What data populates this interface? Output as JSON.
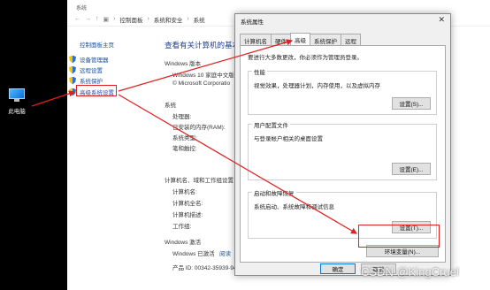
{
  "desktop": {
    "icon_label": "此电脑"
  },
  "window": {
    "title": "系统",
    "breadcrumb": [
      "控制面板",
      "系统和安全",
      "系统"
    ]
  },
  "sidebar": {
    "home": "控制面板主页",
    "items": [
      {
        "label": "设备管理器"
      },
      {
        "label": "远程设置"
      },
      {
        "label": "系统保护"
      },
      {
        "label": "高级系统设置"
      }
    ]
  },
  "main": {
    "heading": "查看有关计算机的基本",
    "edition_section": "Windows 版本",
    "edition": "Windows 10 家庭中文版",
    "copyright": "© Microsoft Corporatio",
    "system_section": "系统",
    "processor_label": "处理器:",
    "ram_label": "已安装的内存(RAM):",
    "sys_type_label": "系统类型:",
    "pen_label": "笔和触控:",
    "computer_section": "计算机名、域和工作组设置",
    "computer_name_label": "计算机名:",
    "full_name_label": "计算机全名:",
    "desc_label": "计算机描述:",
    "workgroup_label": "工作组:",
    "activation_section": "Windows 激活",
    "activated": "Windows 已激活",
    "license_link": "阅读",
    "product_id": "产品 ID: 00342-35939-94"
  },
  "dialog": {
    "title": "系统属性",
    "close": "✕",
    "tabs": [
      "计算机名",
      "硬件",
      "高级",
      "系统保护",
      "远程"
    ],
    "active_tab": "高级",
    "note": "要进行大多数更改，你必须作为管理员登录。",
    "performance": {
      "label": "性能",
      "desc": "视觉效果，处理器计划，内存使用，以及虚拟内存",
      "button": "设置(S)..."
    },
    "profiles": {
      "label": "用户配置文件",
      "desc": "与登录帐户相关的桌面设置",
      "button": "设置(E)..."
    },
    "startup": {
      "label": "启动和故障恢复",
      "desc": "系统启动、系统故障和调试信息",
      "button": "设置(T)..."
    },
    "env_button": "环境变量(N)...",
    "ok": "确定",
    "cancel": "取消"
  },
  "watermark": "CSDN @KingCruel",
  "colors": {
    "accent": "#0078d7",
    "highlight": "#e02020",
    "link": "#1a4fa0"
  }
}
